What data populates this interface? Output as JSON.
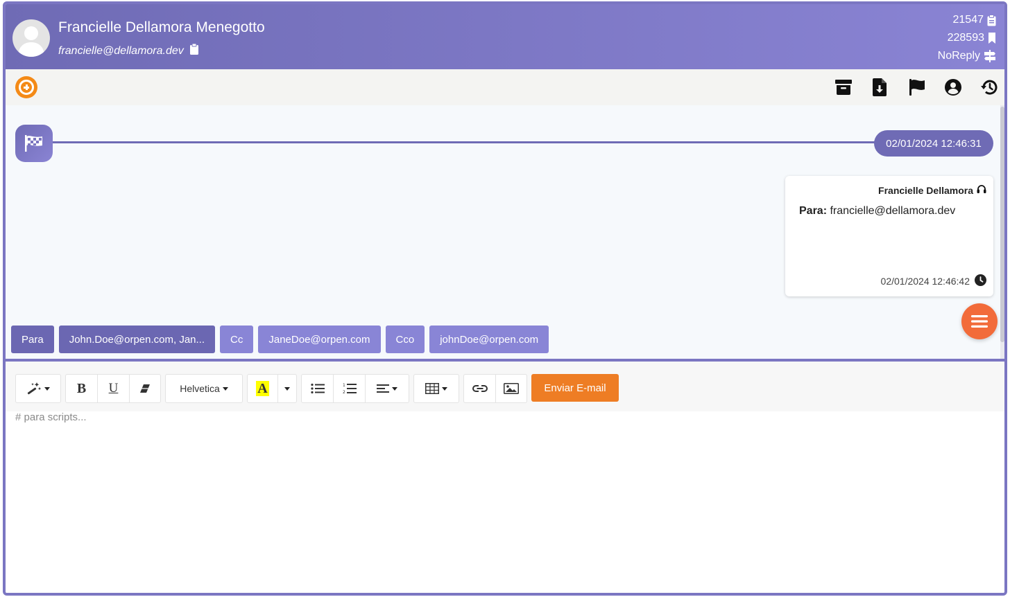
{
  "header": {
    "name": "Francielle Dellamora Menegotto",
    "email": "francielle@dellamora.dev",
    "stats": [
      {
        "value": "21547",
        "icon": "clipboard-icon"
      },
      {
        "value": "228593",
        "icon": "bookmark-icon"
      },
      {
        "value": "NoReply",
        "icon": "signpost-icon"
      }
    ]
  },
  "toolbar": {
    "actions": [
      "archive-icon",
      "file-download-icon",
      "flag-icon",
      "user-circle-icon",
      "history-icon"
    ]
  },
  "timeline": {
    "start_time": "02/01/2024 12:46:31"
  },
  "message": {
    "sender": "Francielle Dellamora",
    "to_label": "Para:",
    "to_value": "francielle@dellamora.dev",
    "time": "02/01/2024 12:46:42"
  },
  "recipients": {
    "para_label": "Para",
    "para_value": "John.Doe@orpen.com, Jan...",
    "cc_label": "Cc",
    "cc_value": "JaneDoe@orpen.com",
    "cco_label": "Cco",
    "cco_value": "johnDoe@orpen.com"
  },
  "editor": {
    "font_name": "Helvetica",
    "highlight_letter": "A",
    "bold_letter": "B",
    "underline_letter": "U",
    "send_label": "Enviar E-mail",
    "placeholder": "# para scripts..."
  },
  "colors": {
    "accent": "#6f6bb5",
    "orange": "#f48a17",
    "fab": "#f26b3a"
  }
}
